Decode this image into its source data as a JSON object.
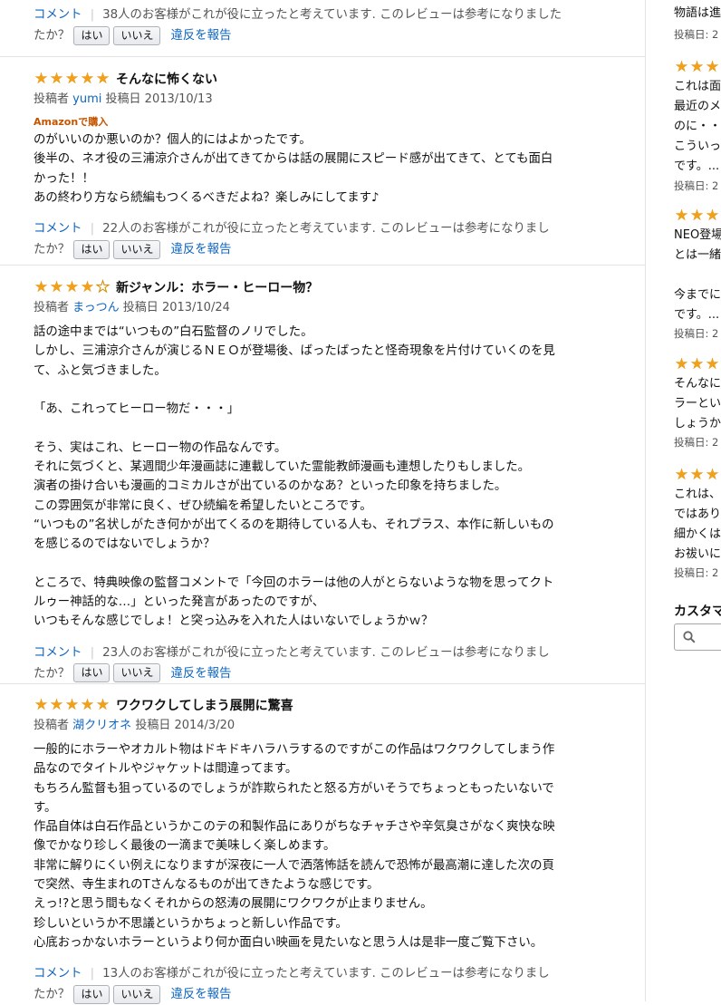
{
  "reviews": [
    {
      "title": "",
      "stars": 0,
      "author_label": "",
      "author": "",
      "date_label": "",
      "date": "",
      "badge": "",
      "body": [],
      "comment": "コメント",
      "helpful": "38人のお客様がこれが役に立ったと考えています. このレビューは参考になりました",
      "helpful_cont": "たか？",
      "yes": "はい",
      "no": "いいえ",
      "report": "違反を報告"
    },
    {
      "title": "そんなに怖くない",
      "stars": 5,
      "author_label": "投稿者",
      "author": "yumi",
      "date_label": "投稿日",
      "date": "2013/10/13",
      "badge": "Amazonで購入",
      "body": [
        "のがいいのか悪いのか？個人的にはよかったです。",
        "後半の、ネオ役の三浦涼介さんが出てきてからは話の展開にスピード感が出てきて、とても面白",
        "かった！！",
        "あの終わり方なら続編もつくるべきだよね？楽しみにしてます♪"
      ],
      "comment": "コメント",
      "helpful": "22人のお客様がこれが役に立ったと考えています. このレビューは参考になりまし",
      "helpful_cont": "たか？",
      "yes": "はい",
      "no": "いいえ",
      "report": "違反を報告"
    },
    {
      "title": "新ジャンル：ホラー・ヒーロー物？",
      "stars": 4,
      "author_label": "投稿者",
      "author": "まっつん",
      "date_label": "投稿日",
      "date": "2013/10/24",
      "badge": "",
      "body": [
        "話の途中までは“いつもの”白石監督のノリでした。",
        "しかし、三浦涼介さんが演じるＮＥＯが登場後、ばったばったと怪奇現象を片付けていくのを見",
        "て、ふと気づきました。",
        "",
        "「あ、これってヒーロー物だ・・・」",
        "",
        "そう、実はこれ、ヒーロー物の作品なんです。",
        "それに気づくと、某週間少年漫画誌に連載していた霊能教師漫画も連想したりもしました。",
        "演者の掛け合いも漫画的コミカルさが出ているのかなあ？といった印象を持ちました。",
        "この雰囲気が非常に良く、ぜひ続編を希望したいところです。",
        "“いつもの”名状しがたき何かが出てくるのを期待している人も、それプラス、本作に新しいもの",
        "を感じるのではないでしょうか？",
        "",
        "ところで、特典映像の監督コメントで「今回のホラーは他の人がとらないような物を思ってクト",
        "ルゥー神話的な…」といった発言があったのですが、",
        "いつもそんな感じでしょ！と突っ込みを入れた人はいないでしょうかｗ？"
      ],
      "comment": "コメント",
      "helpful": "23人のお客様がこれが役に立ったと考えています. このレビューは参考になりまし",
      "helpful_cont": "たか？",
      "yes": "はい",
      "no": "いいえ",
      "report": "違反を報告"
    },
    {
      "title": "ワクワクしてしまう展開に驚喜",
      "stars": 5,
      "author_label": "投稿者",
      "author": "湖クリオネ",
      "date_label": "投稿日",
      "date": "2014/3/20",
      "badge": "",
      "body": [
        "一般的にホラーやオカルト物はドキドキハラハラするのですがこの作品はワクワクしてしまう作",
        "品なのでタイトルやジャケットは間違ってます。",
        "もちろん監督も狙っているのでしょうが詐欺られたと怒る方がいそうでちょっともったいないで",
        "す。",
        "作品自体は白石作品というかこのテの和製作品にありがちなチャチさや辛気臭さがなく爽快な映",
        "像でかなり珍しく最後の一滴まで美味しく楽しめます。",
        "非常に解りにくい例えになりますが深夜に一人で洒落怖話を読んで恐怖が最高潮に達した次の頁",
        "で突然、寺生まれのTさんなるものが出てきたような感じです。",
        "えっ!?と思う間もなくそれからの怒涛の展開にワクワクが止まりません。",
        "珍しいというか不思議というかちょっと新しい作品です。",
        "心底おっかないホラーというより何か面白い映画を見たいなと思う人は是非一度ご覧下さい。"
      ],
      "comment": "コメント",
      "helpful": "13人のお客様がこれが役に立ったと考えています. このレビューは参考になりまし",
      "helpful_cont": "たか？",
      "yes": "はい",
      "no": "いいえ",
      "report": "違反を報告"
    }
  ],
  "sidebar": {
    "top_text": "物語は進",
    "top_date": "投稿日: 2",
    "snippets": [
      {
        "lines": [
          "これは面",
          "最近のメ",
          "のに・・",
          "こういっ",
          "です。..."
        ],
        "date": "投稿日: 2"
      },
      {
        "lines": [
          "NEO登場",
          "とは一緒",
          "",
          "今までに",
          "です。..."
        ],
        "date": "投稿日: 2"
      },
      {
        "lines": [
          "そんなに",
          "ラーとい",
          "しょうか"
        ],
        "date": "投稿日: 2"
      },
      {
        "lines": [
          "これは、",
          "ではあり",
          "細かくは",
          "お祓いに"
        ],
        "date": "投稿日: 2"
      }
    ],
    "search_heading": "カスタマ"
  },
  "colors": {
    "link": "#0f66c0",
    "star": "#f0a01a",
    "badge": "#c45500"
  }
}
